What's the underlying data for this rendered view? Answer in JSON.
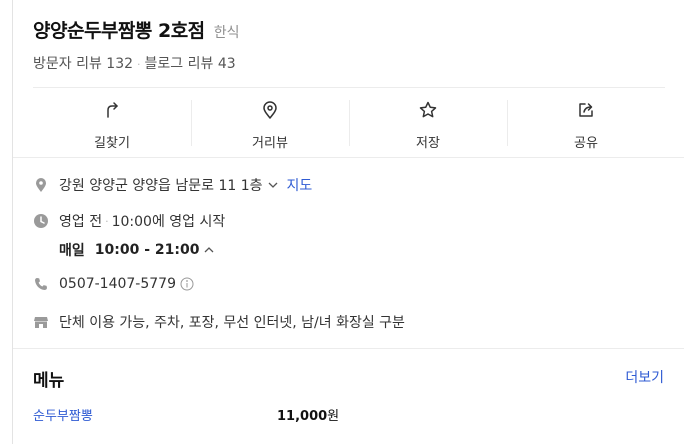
{
  "place": {
    "name": "양양순두부짬뽕 2호점",
    "category": "한식",
    "visitor_reviews": "방문자 리뷰 132",
    "blog_reviews": "블로그 리뷰 43"
  },
  "actions": [
    {
      "label": "길찾기",
      "icon": "directions-icon"
    },
    {
      "label": "거리뷰",
      "icon": "street-view-icon"
    },
    {
      "label": "저장",
      "icon": "star-icon"
    },
    {
      "label": "공유",
      "icon": "share-icon"
    }
  ],
  "info": {
    "address": "강원 양양군 양양읍 남문로 11 1층",
    "map_label": "지도",
    "status": "영업 전",
    "status_detail": "10:00에 영업 시작",
    "hours_label": "매일",
    "hours_value": "10:00 - 21:00",
    "phone": "0507-1407-5779",
    "amenities": "단체 이용 가능, 주차, 포장, 무선 인터넷, 남/녀 화장실 구분"
  },
  "menu": {
    "title": "메뉴",
    "more_label": "더보기",
    "items": [
      {
        "name": "순두부짬뽕",
        "price": "11,000",
        "unit": "원"
      }
    ]
  },
  "colors": {
    "link": "#2f5bd3",
    "icon_gray": "#9a9a9a",
    "divider": "#ececec"
  }
}
